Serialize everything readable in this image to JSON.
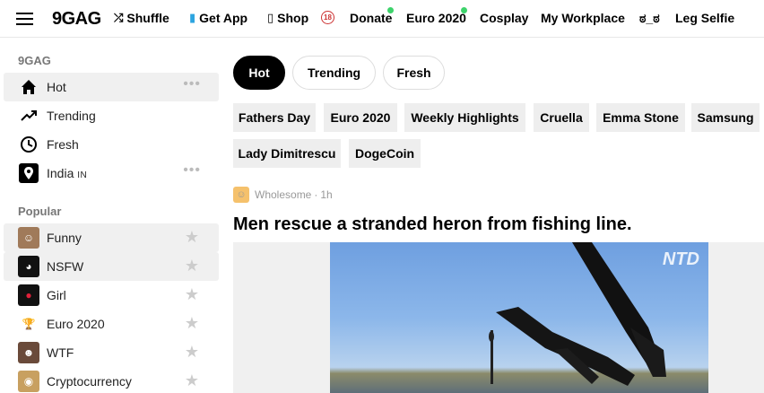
{
  "topbar": {
    "logo": "9GAG",
    "nav": [
      {
        "label": "Shuffle",
        "icon": "shuffle-icon"
      },
      {
        "label": "Get App",
        "icon": "phone-icon"
      },
      {
        "label": "Shop",
        "icon": "bag-icon"
      },
      {
        "label": "",
        "icon": "18-plus-icon"
      },
      {
        "label": "Donate",
        "icon": "",
        "dot": true
      },
      {
        "label": "Euro 2020",
        "icon": "",
        "dot": true
      },
      {
        "label": "Cosplay",
        "icon": ""
      },
      {
        "label": "My Workplace",
        "icon": ""
      },
      {
        "label": "ಠ_ಠ",
        "icon": ""
      },
      {
        "label": "Leg Selfie",
        "icon": ""
      }
    ]
  },
  "sidebar": {
    "section1_title": "9GAG",
    "main_items": [
      {
        "label": "Hot",
        "icon": "home-icon",
        "active": true,
        "more": "•••"
      },
      {
        "label": "Trending",
        "icon": "trending-icon"
      },
      {
        "label": "Fresh",
        "icon": "clock-icon"
      },
      {
        "label": "India",
        "suffix": "IN",
        "icon": "location-icon",
        "more": "•••"
      }
    ],
    "section2_title": "Popular",
    "popular_items": [
      {
        "label": "Funny",
        "active": true
      },
      {
        "label": "NSFW",
        "active": true
      },
      {
        "label": "Girl"
      },
      {
        "label": "Euro 2020"
      },
      {
        "label": "WTF"
      },
      {
        "label": "Cryptocurrency"
      }
    ],
    "star": "★"
  },
  "main": {
    "tabs": [
      {
        "label": "Hot",
        "active": true
      },
      {
        "label": "Trending"
      },
      {
        "label": "Fresh"
      }
    ],
    "tags_row1": [
      "Fathers Day",
      "Euro 2020",
      "Weekly Highlights",
      "Cruella",
      "Emma Stone",
      "Samsung"
    ],
    "tags_row2": [
      "Lady Dimitrescu",
      "DogeCoin"
    ],
    "post": {
      "section": "Wholesome",
      "separator": "·",
      "age": "1h",
      "title": "Men rescue a stranded heron from fishing line.",
      "watermark": "NTD"
    }
  },
  "colors": {
    "accent_dot": "#3dd36b",
    "active_pill": "#000000",
    "tag_bg": "#eeeeee"
  }
}
